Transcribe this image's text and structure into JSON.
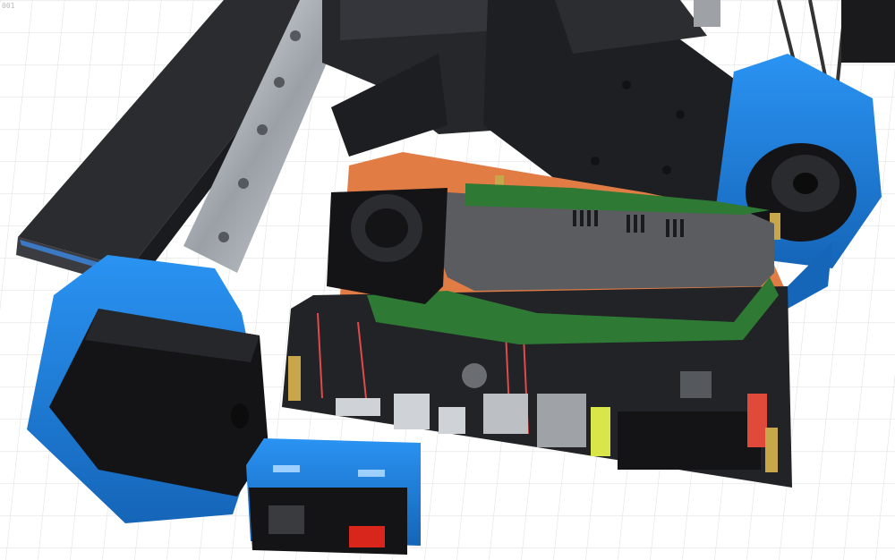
{
  "viewport": {
    "corner_label": "001",
    "background": "#ffffff",
    "grid_color": "#dcdcdc"
  },
  "model": {
    "description_hidden": true,
    "colors": {
      "frame_black": "#1e1f22",
      "frame_dark": "#2b2c30",
      "rail_silver": "#bfc3c7",
      "printed_blue": "#1f86e6",
      "printed_blue_dark": "#1565b8",
      "pcb_black": "#222326",
      "pcb_trace": "#e04a4a",
      "shroud_grey": "#5a5c60",
      "green_bracket": "#2e7a34",
      "orange_part": "#e27c45",
      "brass": "#c8a64a",
      "yellow_connector": "#d8e64a",
      "red_switch": "#d9261c",
      "fan_black": "#141416"
    }
  }
}
